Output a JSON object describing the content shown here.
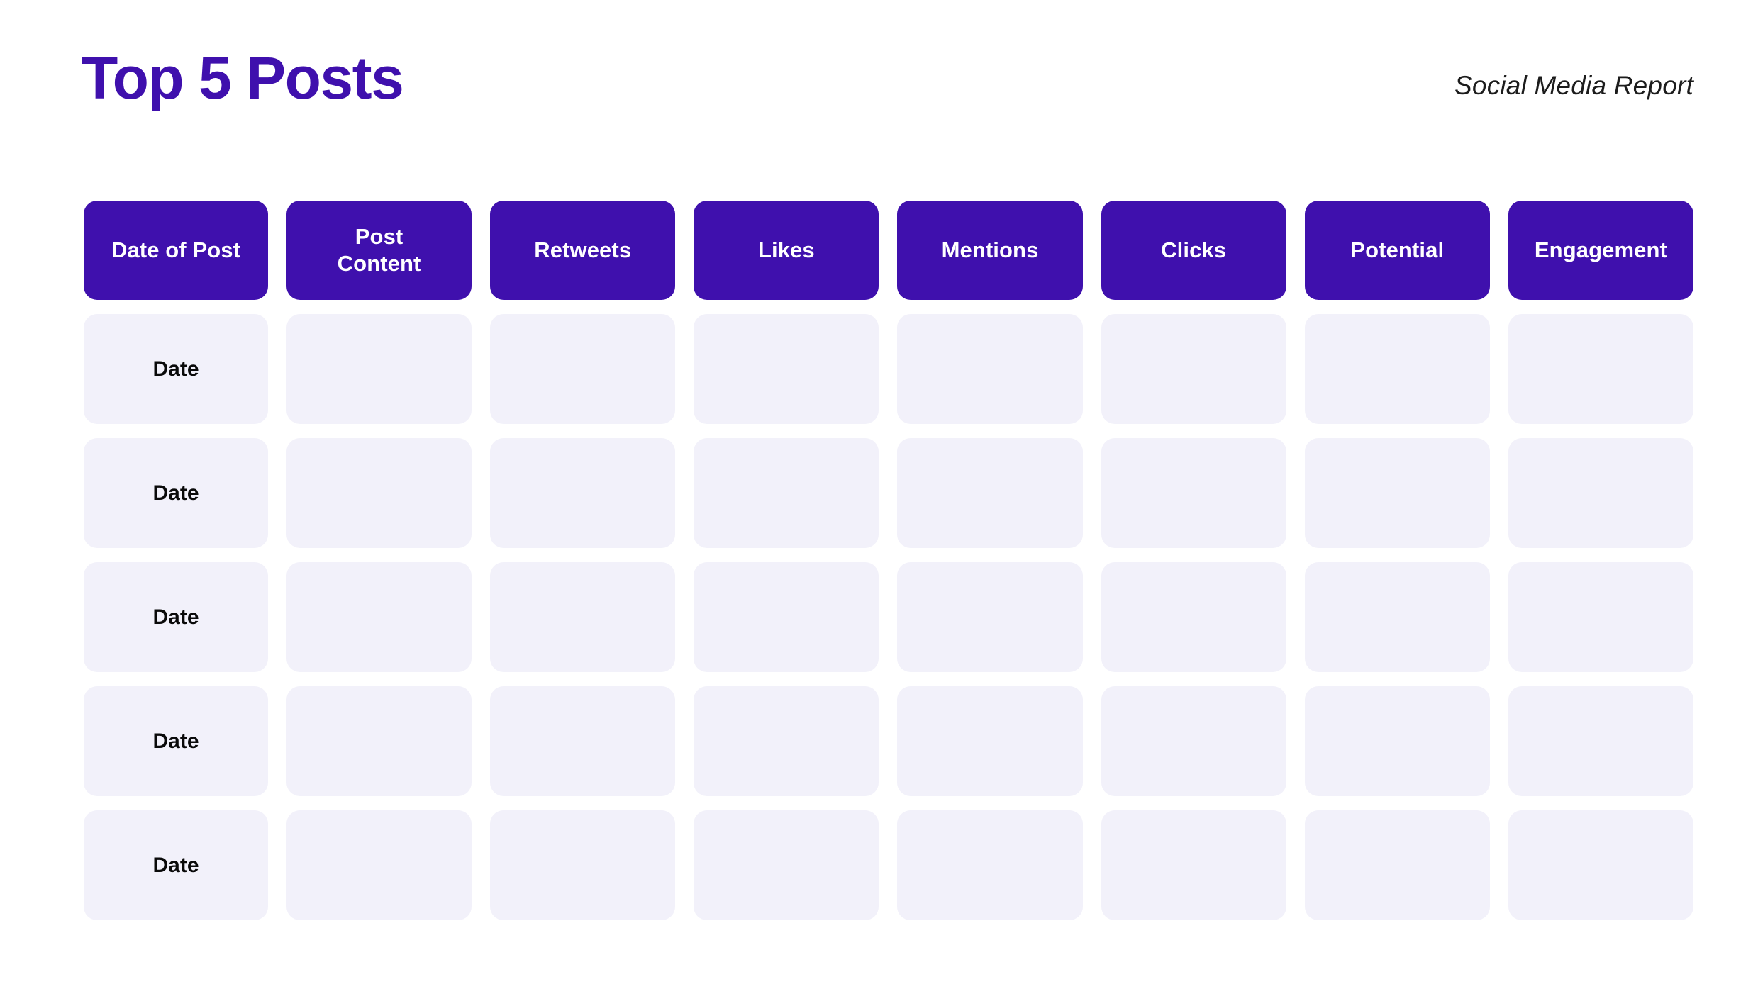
{
  "header": {
    "title": "Top 5 Posts",
    "report_label": "Social Media Report"
  },
  "theme": {
    "accent_purple": "#3f10ad",
    "cell_background": "#f2f1fa",
    "page_background": "#ffffff",
    "header_text": "#ffffff",
    "body_text": "#0a0a0a"
  },
  "table": {
    "columns": [
      {
        "label": "Date of Post",
        "line1": "Date of Post",
        "line2": ""
      },
      {
        "label": "Post Content",
        "line1": "Post",
        "line2": "Content"
      },
      {
        "label": "Retweets",
        "line1": "Retweets",
        "line2": ""
      },
      {
        "label": "Likes",
        "line1": "Likes",
        "line2": ""
      },
      {
        "label": "Mentions",
        "line1": "Mentions",
        "line2": ""
      },
      {
        "label": "Clicks",
        "line1": "Clicks",
        "line2": ""
      },
      {
        "label": "Potential",
        "line1": "Potential",
        "line2": ""
      },
      {
        "label": "Engagement",
        "line1": "Engagement",
        "line2": ""
      }
    ],
    "rows": [
      {
        "date": "Date",
        "post_content": "",
        "retweets": "",
        "likes": "",
        "mentions": "",
        "clicks": "",
        "potential": "",
        "engagement": ""
      },
      {
        "date": "Date",
        "post_content": "",
        "retweets": "",
        "likes": "",
        "mentions": "",
        "clicks": "",
        "potential": "",
        "engagement": ""
      },
      {
        "date": "Date",
        "post_content": "",
        "retweets": "",
        "likes": "",
        "mentions": "",
        "clicks": "",
        "potential": "",
        "engagement": ""
      },
      {
        "date": "Date",
        "post_content": "",
        "retweets": "",
        "likes": "",
        "mentions": "",
        "clicks": "",
        "potential": "",
        "engagement": ""
      },
      {
        "date": "Date",
        "post_content": "",
        "retweets": "",
        "likes": "",
        "mentions": "",
        "clicks": "",
        "potential": "",
        "engagement": ""
      }
    ]
  }
}
